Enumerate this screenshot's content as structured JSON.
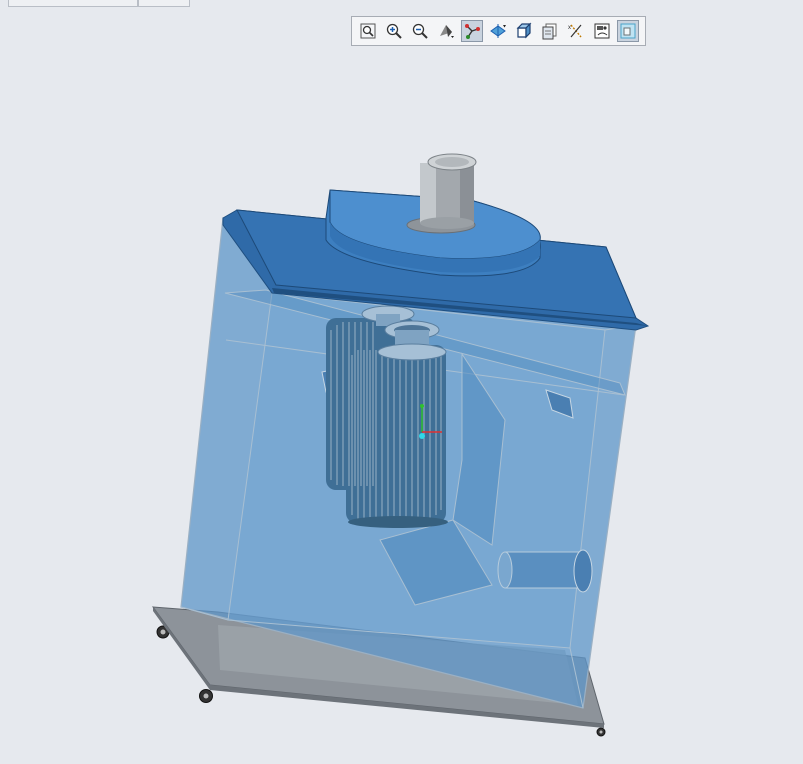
{
  "header": {
    "tabs": [
      {
        "label": ""
      },
      {
        "label": ""
      }
    ]
  },
  "toolbar": {
    "buttons": [
      {
        "name": "refit-icon",
        "active": false
      },
      {
        "name": "zoom-in-icon",
        "active": false
      },
      {
        "name": "zoom-out-icon",
        "active": false
      },
      {
        "name": "display-style-icon",
        "active": false
      },
      {
        "name": "datum-display-icon",
        "active": true
      },
      {
        "name": "spin-center-icon",
        "active": false
      },
      {
        "name": "saved-views-icon",
        "active": false
      },
      {
        "name": "view-manager-icon",
        "active": false
      },
      {
        "name": "annotation-display-icon",
        "active": false
      },
      {
        "name": "appearance-icon",
        "active": false
      },
      {
        "name": "transparency-icon",
        "active": true
      }
    ]
  },
  "model": {
    "name": "dust-collector-assembly",
    "body_color": "#5e96c8",
    "edge_color": "#9ab0c4",
    "lid_color": "#2f6aa8",
    "filter_color": "#3f6f96",
    "outlet_color": "#a3a8ad"
  }
}
